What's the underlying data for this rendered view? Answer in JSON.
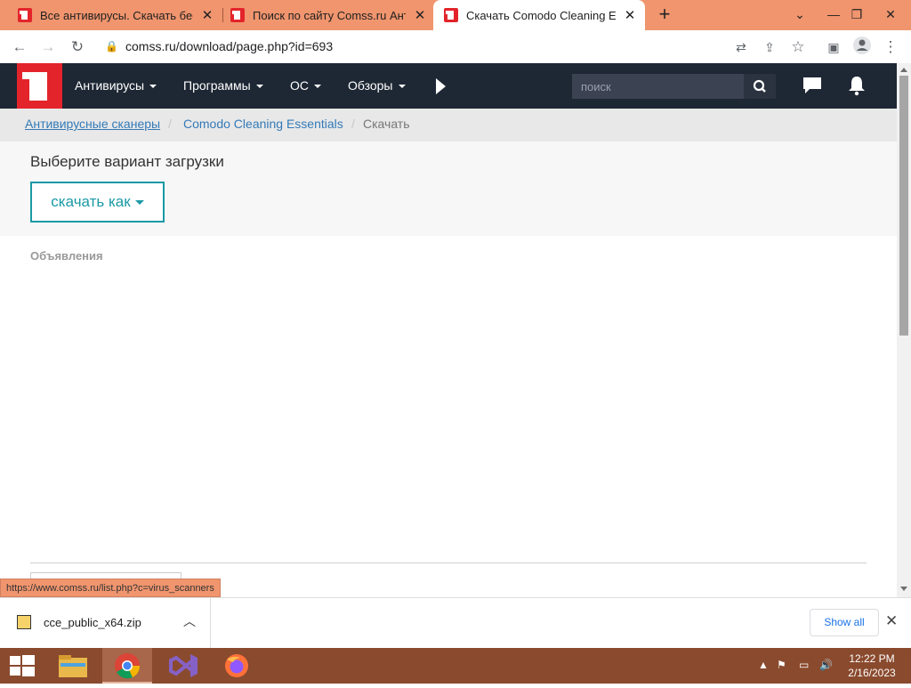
{
  "browser": {
    "tabs": [
      {
        "title": "Все антивирусы. Скачать бесплатные антивирусы"
      },
      {
        "title": "Поиск по сайту Comss.ru Антивирусы"
      },
      {
        "title": "Скачать Comodo Cleaning Essentials"
      }
    ],
    "active_tab_index": 2,
    "new_tab_label": "+",
    "url": "comss.ru/download/page.php?id=693"
  },
  "site": {
    "nav": [
      {
        "label": "Антивирусы"
      },
      {
        "label": "Программы"
      },
      {
        "label": "ОС"
      },
      {
        "label": "Обзоры"
      }
    ],
    "search_placeholder": "поиск"
  },
  "breadcrumb": {
    "items": [
      "Антивирусные сканеры",
      "Comodo Cleaning Essentials",
      "Скачать"
    ],
    "separator": "/"
  },
  "download": {
    "title": "Выберите вариант загрузки",
    "button_label": "скачать как"
  },
  "ads_label": "Объявления",
  "status_url": "https://www.comss.ru/list.php?c=virus_scanners",
  "download_bar": {
    "file_name": "cce_public_x64.zip",
    "show_all": "Show all"
  },
  "taskbar": {
    "time": "12:22 PM",
    "date": "2/16/2023",
    "apps": [
      "windows-start",
      "file-explorer",
      "google-chrome",
      "visual-studio",
      "firefox"
    ]
  },
  "colors": {
    "tabstrip": "#f0956e",
    "site_nav": "#1e2734",
    "brand_red": "#e3242b",
    "accent_teal": "#1a9aa6",
    "taskbar": "#8a4a2e"
  }
}
